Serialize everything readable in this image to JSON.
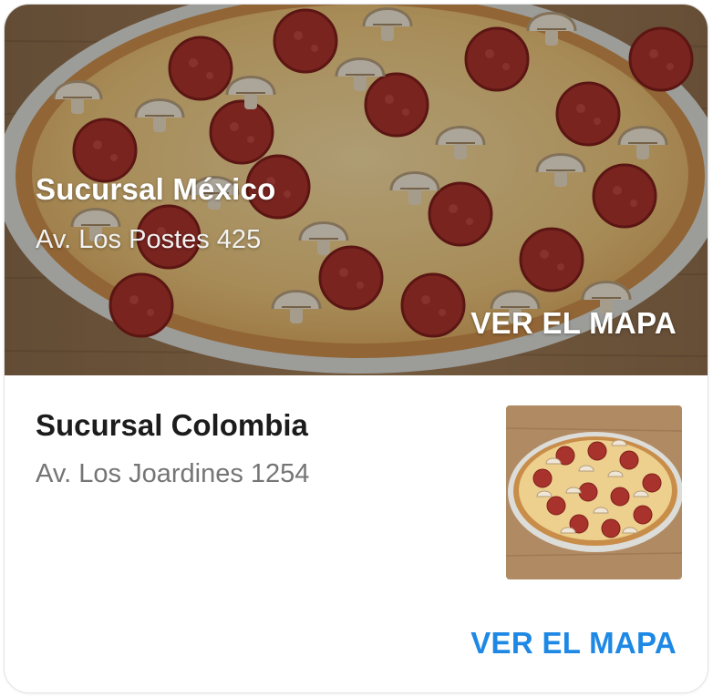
{
  "colors": {
    "accent": "#1e88e5",
    "title_text": "#1c1c1c",
    "secondary_text": "#757575",
    "hero_text": "#ffffff"
  },
  "branches": [
    {
      "name": "Sucursal México",
      "address": "Av. Los Postes 425",
      "map_label": "VER EL MAPA",
      "image": "pizza-pepperoni-mushroom-photo"
    },
    {
      "name": "Sucursal Colombia",
      "address": "Av. Los Joardines 1254",
      "map_label": "VER EL MAPA",
      "image": "pizza-pepperoni-mushroom-photo"
    }
  ]
}
